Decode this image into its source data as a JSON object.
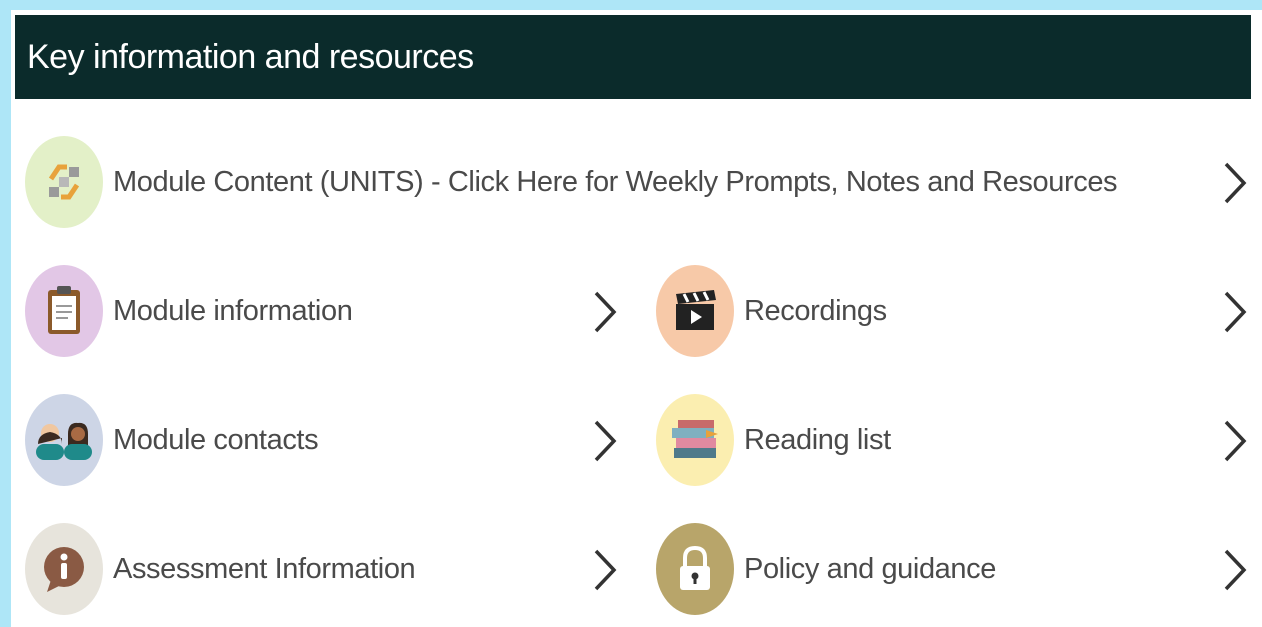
{
  "section": {
    "title": "Key information and resources"
  },
  "items": [
    {
      "label": "Module Content (UNITS) - Click Here for Weekly Prompts, Notes and Resources",
      "icon": "recycle-arrows-icon",
      "circle_color": "#e3f0c8"
    },
    {
      "label": "Module information",
      "icon": "clipboard-icon",
      "circle_color": "#e2c7e6"
    },
    {
      "label": "Recordings",
      "icon": "clapperboard-icon",
      "circle_color": "#f7c9a8"
    },
    {
      "label": "Module contacts",
      "icon": "people-icon",
      "circle_color": "#cdd5e6"
    },
    {
      "label": "Reading list",
      "icon": "books-icon",
      "circle_color": "#fbeeb0"
    },
    {
      "label": "Assessment Information",
      "icon": "info-icon",
      "circle_color": "#e7e4dc"
    },
    {
      "label": "Policy and guidance",
      "icon": "padlock-icon",
      "circle_color": "#b8a56a"
    }
  ],
  "colors": {
    "header_bg": "#0b2b2b",
    "page_bg": "#aee6f7",
    "text": "#4a4a4a"
  }
}
